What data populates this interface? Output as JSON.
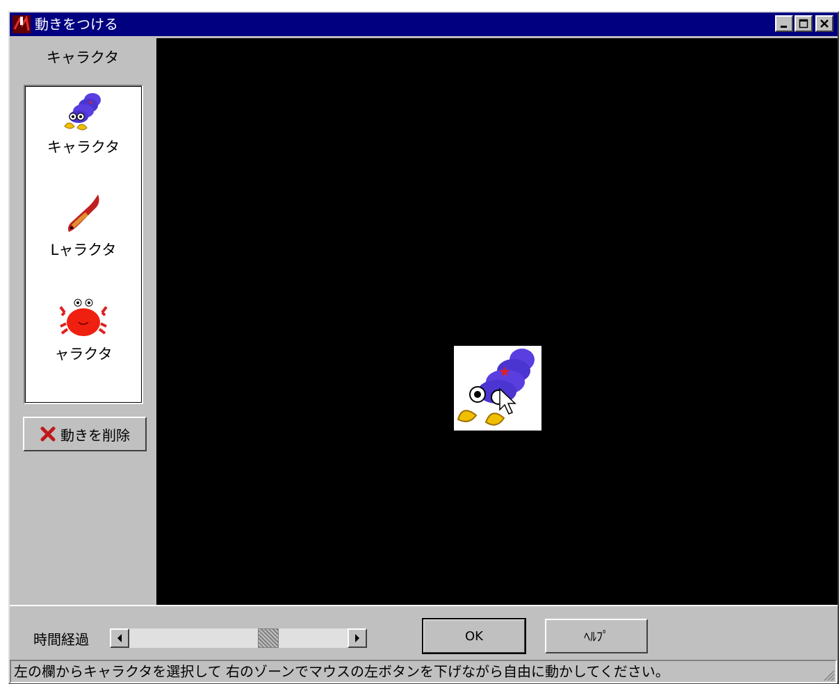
{
  "window": {
    "title": "動きをつける"
  },
  "left_panel": {
    "title": "キャラクタ",
    "characters": [
      {
        "label": "キャラクタ",
        "icon": "purple-hermit-crab-icon"
      },
      {
        "label": "Lャラクタ",
        "icon": "red-fish-icon"
      },
      {
        "label": "ャラクタ",
        "icon": "red-crab-icon"
      }
    ],
    "delete_button": "動きを削除"
  },
  "canvas": {
    "placed_character_icon": "purple-hermit-crab-icon"
  },
  "bottom": {
    "time_label": "時間経過",
    "slider_position": 0.65,
    "ok_button": "OK",
    "help_button": "ﾍﾙﾌﾟ"
  },
  "status": {
    "text": "左の欄からキャラクタを選択して 右のゾーンでマウスの左ボタンを下げながら自由に動かしてください。"
  },
  "colors": {
    "titlebar": "#000080",
    "face": "#c0c0c0",
    "canvas": "#000000",
    "delete_x": "#c01818"
  }
}
